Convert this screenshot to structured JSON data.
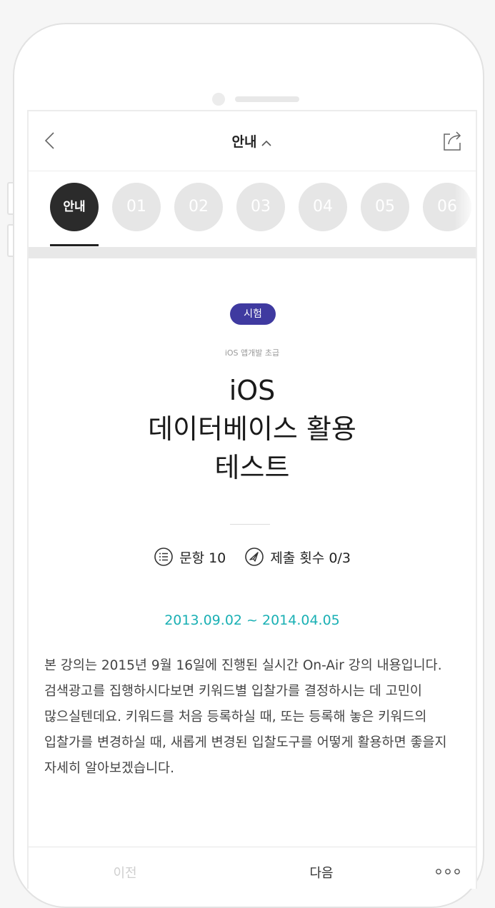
{
  "header": {
    "title": "안내",
    "back_icon": "chevron-left-icon",
    "share_icon": "share-icon"
  },
  "tabs": [
    {
      "label": "안내",
      "active": true
    },
    {
      "label": "01",
      "active": false
    },
    {
      "label": "02",
      "active": false
    },
    {
      "label": "03",
      "active": false
    },
    {
      "label": "04",
      "active": false
    },
    {
      "label": "05",
      "active": false
    },
    {
      "label": "06",
      "active": false
    }
  ],
  "content": {
    "badge": "시험",
    "category": "iOS 앱개발 초급",
    "title_lines": [
      "iOS",
      "데이터베이스 활용",
      "테스트"
    ],
    "questions": "문항 10",
    "submissions": "제출 횟수 0/3",
    "dates": "2013.09.02 ~ 2014.04.05",
    "description": "본 강의는 2015년 9월 16일에 진행된 실시간 On-Air 강의 내용입니다.  검색광고를 집행하시다보면 키워드별 입찰가를 결정하시는 데 고민이 많으실텐데요. 키워드를 처음 등록하실 때, 또는 등록해 놓은 키워드의 입찰가를 변경하실 때, 새롭게 변경된 입찰도구를 어떻게 활용하면 좋을지  자세히 알아보겠습니다."
  },
  "footer": {
    "prev": "이전",
    "next": "다음",
    "more_icon": "more-dots-icon"
  },
  "colors": {
    "badge": "#3f3aa0",
    "dates": "#1ab0b4",
    "active_tab": "#2b2b2b",
    "inactive_tab": "#e6e6e6"
  }
}
